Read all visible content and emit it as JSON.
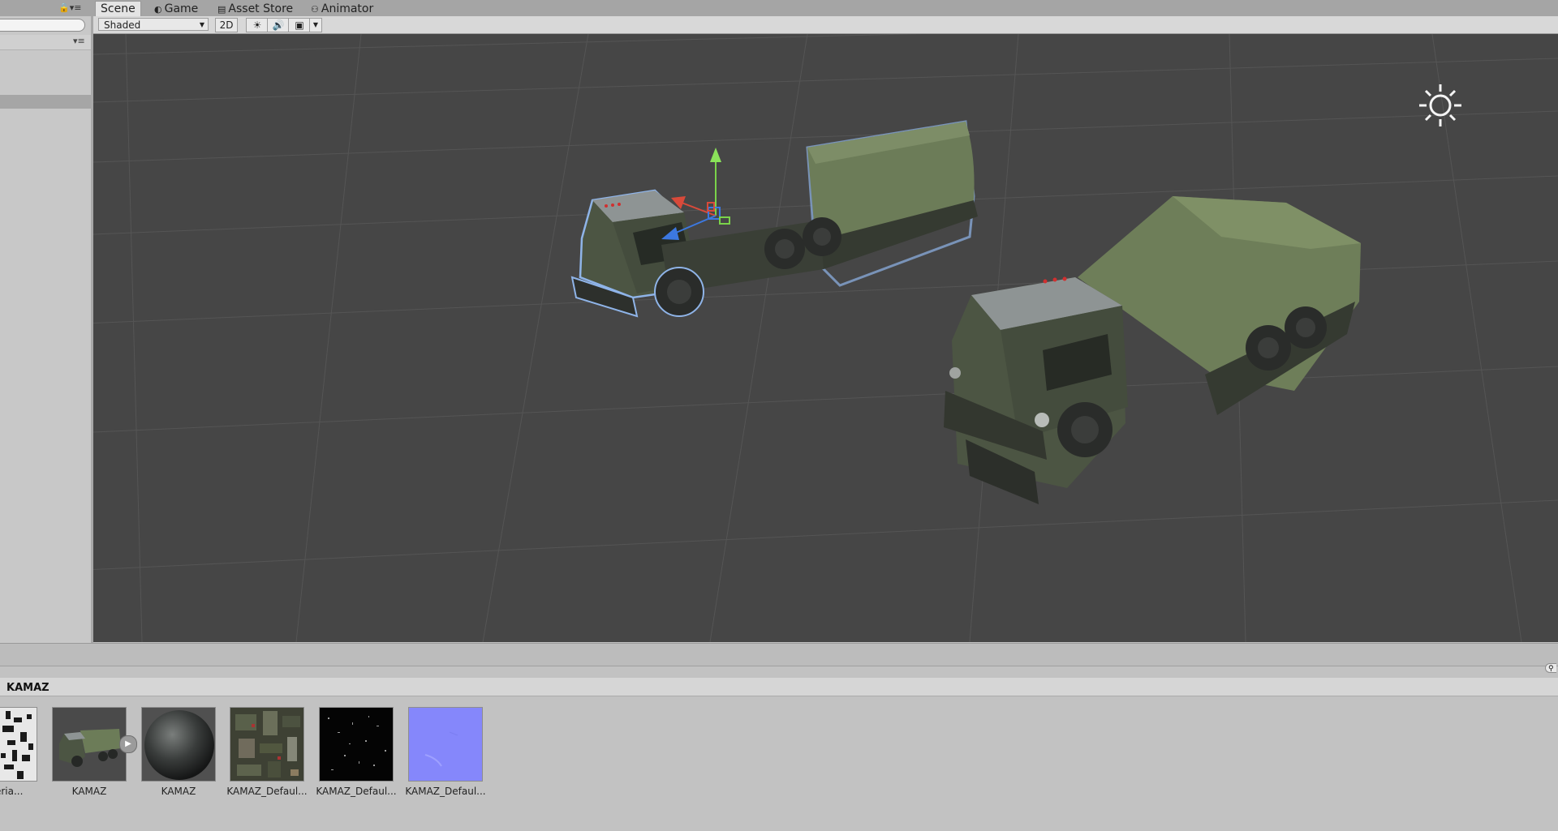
{
  "tabs": {
    "scene": "Scene",
    "game": "Game",
    "asset_store": "Asset Store",
    "animator": "Animator"
  },
  "toolbar": {
    "shading_mode": "Shaded",
    "mode_2d": "2D"
  },
  "project": {
    "folder": "KAMAZ",
    "assets": [
      {
        "label": "Materia..."
      },
      {
        "label": "KAMAZ"
      },
      {
        "label": "KAMAZ"
      },
      {
        "label": "KAMAZ_Defaul..."
      },
      {
        "label": "KAMAZ_Defaul..."
      },
      {
        "label": "KAMAZ_Defaul..."
      }
    ]
  },
  "colors": {
    "viewport_bg": "#464646",
    "truck_body": "#4e5845",
    "tarp": "#6f7f5b",
    "normal_map": "#8a8cff"
  }
}
